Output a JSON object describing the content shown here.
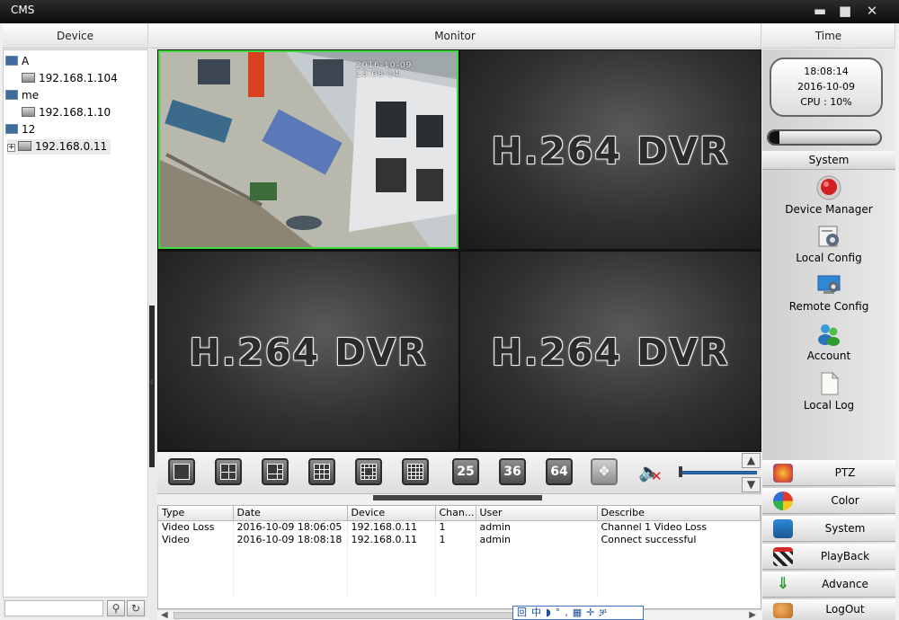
{
  "window": {
    "title": "CMS",
    "controls": {
      "minimize": "▬",
      "maximize": "■",
      "close": "✕"
    }
  },
  "columns": {
    "device": "Device",
    "monitor": "Monitor",
    "time": "Time"
  },
  "device_tree": [
    {
      "name": "A",
      "kind": "group"
    },
    {
      "name": "192.168.1.104",
      "kind": "device"
    },
    {
      "name": "me",
      "kind": "group"
    },
    {
      "name": "192.168.1.10",
      "kind": "device"
    },
    {
      "name": "12",
      "kind": "group"
    },
    {
      "name": "192.168.0.11",
      "kind": "device",
      "expander": "+",
      "selected": true
    }
  ],
  "device_search": {
    "search_icon": "⚲",
    "refresh_icon": "↻"
  },
  "monitor": {
    "active_osd": "2016-10-09 18:08:14",
    "placeholder_text": "H.264 DVR"
  },
  "layout_buttons": {
    "b25": "25",
    "b36": "36",
    "b64": "64",
    "fullscreen": "✥"
  },
  "toolbar": {
    "mute_icon": "🔈",
    "mute_x": "✕",
    "scroll_up": "▲",
    "scroll_down": "▼"
  },
  "log": {
    "headers": [
      "Type",
      "Date",
      "Device",
      "Chan...",
      "User",
      "Describe"
    ],
    "rows": [
      [
        "Video Loss",
        "2016-10-09 18:06:05",
        "192.168.0.11",
        "1",
        "admin",
        "Channel 1 Video Loss"
      ],
      [
        "Video",
        "2016-10-09 18:08:18",
        "192.168.0.11",
        "1",
        "admin",
        "Connect successful"
      ]
    ]
  },
  "hscroll": {
    "left": "◀",
    "right": "▶"
  },
  "ime_bar": "回中◗°,▦✛ቻ",
  "clock": {
    "time": "18:08:14",
    "date": "2016-10-09",
    "cpu": "CPU : 10%"
  },
  "cpu_level_percent": 10,
  "system": {
    "header": "System",
    "items": [
      {
        "label": "Device Manager",
        "icon": "red-record-icon"
      },
      {
        "label": "Local Config",
        "icon": "local-config-icon"
      },
      {
        "label": "Remote Config",
        "icon": "remote-config-icon"
      },
      {
        "label": "Account",
        "icon": "account-icon"
      },
      {
        "label": "Local Log",
        "icon": "document-icon"
      }
    ]
  },
  "nav": [
    {
      "label": "PTZ",
      "icon": "ptz-icon"
    },
    {
      "label": "Color",
      "icon": "color-wheel-icon"
    },
    {
      "label": "System",
      "icon": "system-icon"
    },
    {
      "label": "PlayBack",
      "icon": "clapper-icon"
    },
    {
      "label": "Advance",
      "icon": "download-arrow-icon"
    },
    {
      "label": "LogOut",
      "icon": "logout-icon"
    }
  ]
}
